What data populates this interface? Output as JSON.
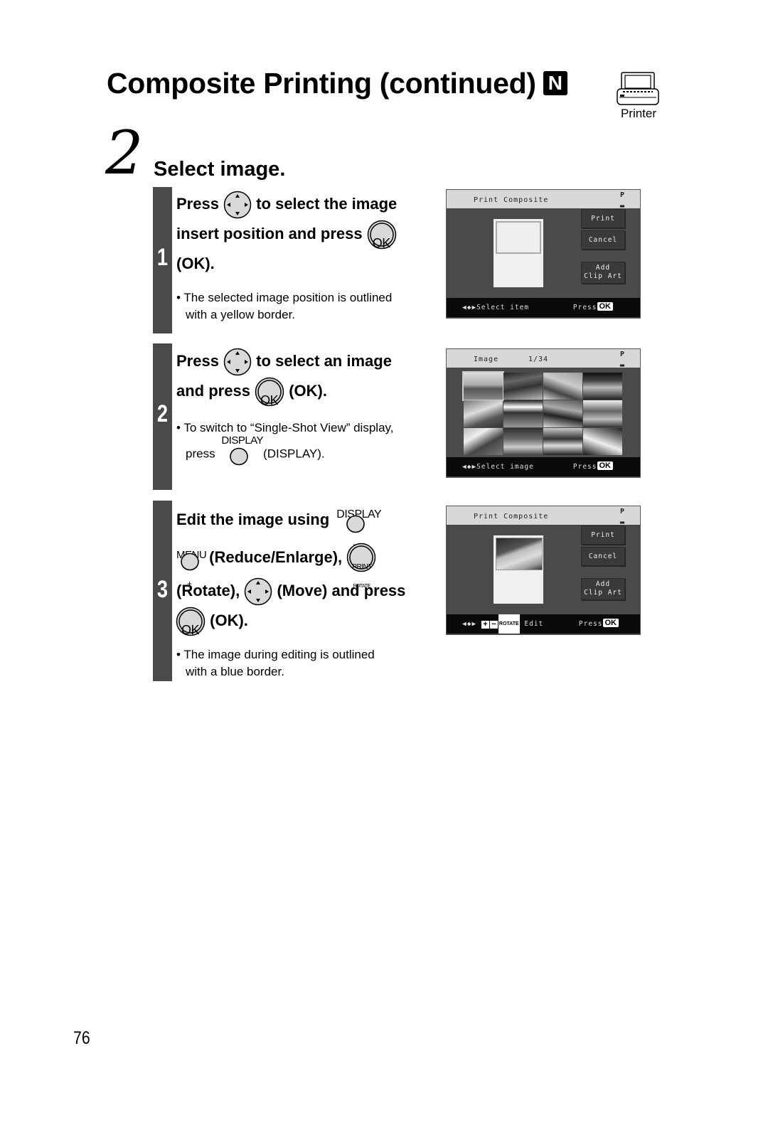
{
  "page": {
    "title": "Composite Printing (continued)",
    "mode_badge": "N",
    "device_icon": "printer-icon",
    "device_label": "Printer",
    "page_number": "76"
  },
  "step": {
    "number": "2",
    "title": "Select image."
  },
  "substeps": [
    {
      "number": "1",
      "instruction": {
        "press": "Press",
        "line1_rest": "to select the image",
        "line2": "insert position and press",
        "line3": "(OK)."
      },
      "note": {
        "bullet": "•",
        "line1": "The selected image position is outlined",
        "line2": "with a yellow border."
      },
      "screen": {
        "header_title": "Print Composite",
        "header_icon": "P",
        "buttons": [
          "Print",
          "Cancel",
          "Add",
          "Clip Art"
        ],
        "footer_left": "Select item",
        "footer_press": "Press",
        "footer_ok": "OK"
      }
    },
    {
      "number": "2",
      "instruction": {
        "press": "Press",
        "line1_rest": "to select an image",
        "line2": "and press",
        "line2_rest": "(OK)."
      },
      "note": {
        "bullet": "•",
        "line1": "To switch to “Single-Shot View” display,",
        "line2_pre": "press",
        "line2_post": "(DISPLAY)."
      },
      "screen": {
        "header_title": "Image",
        "header_counter": "1/34",
        "header_icon": "P",
        "thumbnail_count": 12,
        "footer_left": "Select image",
        "footer_press": "Press",
        "footer_ok": "OK"
      }
    },
    {
      "number": "3",
      "instruction": {
        "line1": "Edit the image using",
        "line2": "(Reduce/Enlarge),",
        "line3_a": "(Rotate),",
        "line3_b": "(Move) and press",
        "line4": "(OK)."
      },
      "note": {
        "bullet": "•",
        "line1": "The image during editing is outlined",
        "line2": "with a blue border."
      },
      "screen": {
        "header_title": "Print Composite",
        "header_icon": "P",
        "buttons": [
          "Print",
          "Cancel",
          "Add",
          "Clip Art"
        ],
        "footer_plus": "+",
        "footer_minus": "−",
        "footer_rotate": "ROTATE",
        "footer_left": "Edit",
        "footer_press": "Press",
        "footer_ok": "OK"
      }
    }
  ],
  "controls": {
    "ok_label": "OK",
    "display_label": "DISPLAY",
    "menu_label": "MENU",
    "print_label": "PRINT",
    "rotate_label": "ROTATE",
    "plus": "+",
    "minus": "−"
  }
}
